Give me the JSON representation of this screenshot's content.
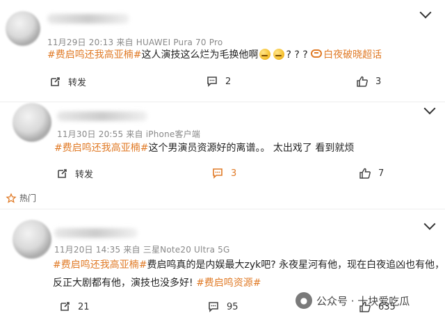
{
  "posts": [
    {
      "meta": "11月29日 20:13  来自 HUAWEI Pura 70 Pro",
      "content": {
        "tag": "#费启鸣还我高亚楠#",
        "text_before_emoji": "这人演技这么烂为毛换他啊",
        "text_after_emoji": "? ? ? ",
        "link_text": "白夜破晓超话"
      },
      "actions": {
        "repost_label": "转发",
        "comment_count": "2",
        "like_count": "3"
      },
      "emoji_names": [
        "sweat-smile-emoji",
        "sweat-smile-emoji"
      ]
    },
    {
      "meta": "11月30日 20:55  来自 iPhone客户端",
      "content": {
        "tag": "#费启鸣还我高亚楠#",
        "text": "这个男演员资源好的离谱。。 太出戏了 看到就烦"
      },
      "actions": {
        "repost_label": "转发",
        "comment_count": "3",
        "like_count": "7"
      }
    },
    {
      "meta": "11月20日 14:35  来自 三星Note20 Ultra 5G",
      "content": {
        "tag_1": "#费启鸣还我高亚楠#",
        "text_1": "费启鸣真的是内娱最大zyk吧? 永夜星河有他，现在白夜追凶也有他，反正大剧都有他，演技也没多好! ",
        "tag_2": "#费启鸣资源#"
      },
      "actions": {
        "repost_count": "21",
        "comment_count": "95",
        "like_count": "635"
      }
    }
  ],
  "hot_section": {
    "label": "热门"
  },
  "watermark": {
    "text": "公众号 · 十块爱吃瓜"
  },
  "colors": {
    "accent": "#e07a26",
    "meta_gray": "#888888",
    "text": "#222222"
  },
  "icons": {
    "repost": "repost-icon",
    "comment": "comment-icon",
    "like": "like-icon",
    "hot": "hot-icon",
    "more": "chevron-down-icon",
    "link": "link-icon",
    "wechat": "wechat-icon"
  }
}
